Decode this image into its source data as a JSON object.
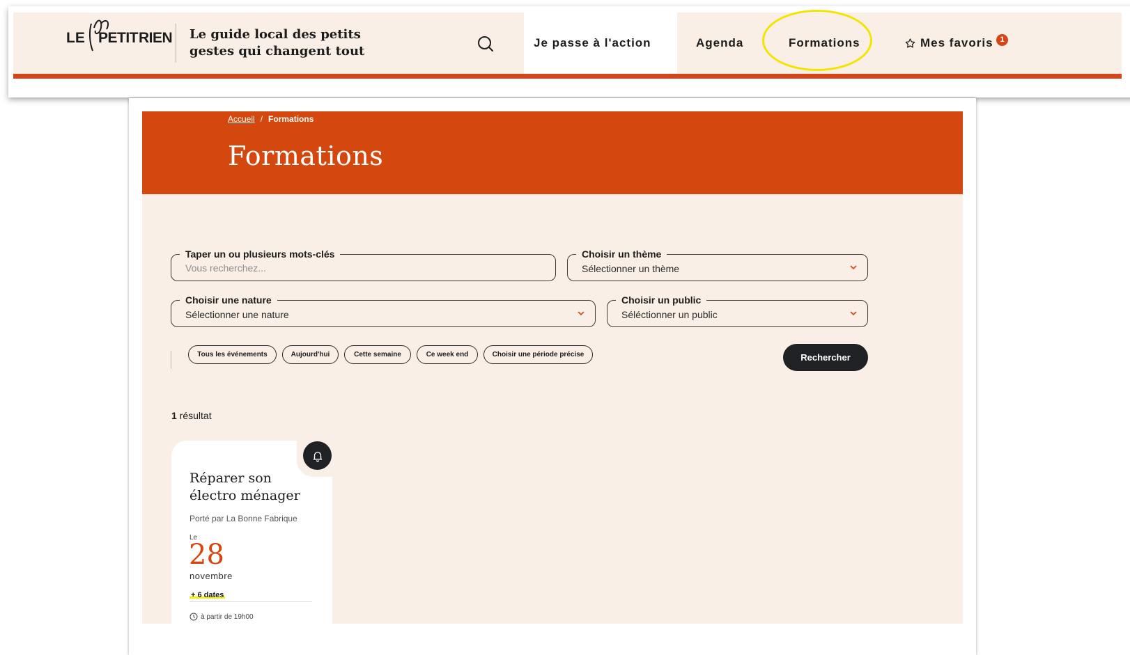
{
  "header": {
    "logo_text": "LE PETIT RIEN",
    "tagline": "Le guide local des petits gestes qui changent tout",
    "search_icon": "search-icon",
    "nav": [
      {
        "label": "Je passe à l'action",
        "active": true
      },
      {
        "label": "Agenda",
        "active": false
      },
      {
        "label": "Formations",
        "active": false,
        "highlighted": true
      },
      {
        "label": "Mes favoris",
        "icon": "star-icon",
        "badge": "1"
      }
    ],
    "accent_color": "#d4461a",
    "highlight_color": "#f2e500"
  },
  "breadcrumb": {
    "home": "Accueil",
    "separator": "/",
    "current": "Formations"
  },
  "page_title": "Formations",
  "filters": {
    "keywords": {
      "label": "Taper un ou plusieurs mots-clés",
      "placeholder": "Vous recherchez..."
    },
    "theme": {
      "label": "Choisir un thème",
      "value": "Sélectionner un thème"
    },
    "nature": {
      "label": "Choisir une nature",
      "value": "Sélectionner une nature"
    },
    "public": {
      "label": "Choisir un public",
      "value": "Séléctionner un public"
    },
    "periods": [
      "Tous les événements",
      "Aujourd'hui",
      "Cette semaine",
      "Ce week end",
      "Choisir une période précise"
    ],
    "submit": "Rechercher"
  },
  "results": {
    "count": "1",
    "label": "résultat"
  },
  "card": {
    "title": "Réparer son électro ménager",
    "organizer": "Porté par La Bonne Fabrique",
    "date_prefix": "Le",
    "day": "28",
    "month": "novembre",
    "more_dates": "+ 6 dates",
    "time": "à partir de 19h00",
    "bell_icon": "bell-icon",
    "clock_icon": "clock-icon"
  },
  "colors": {
    "hero_orange": "#d4470f",
    "cream_background": "#f9efe6",
    "dark_button": "#1f2124"
  }
}
